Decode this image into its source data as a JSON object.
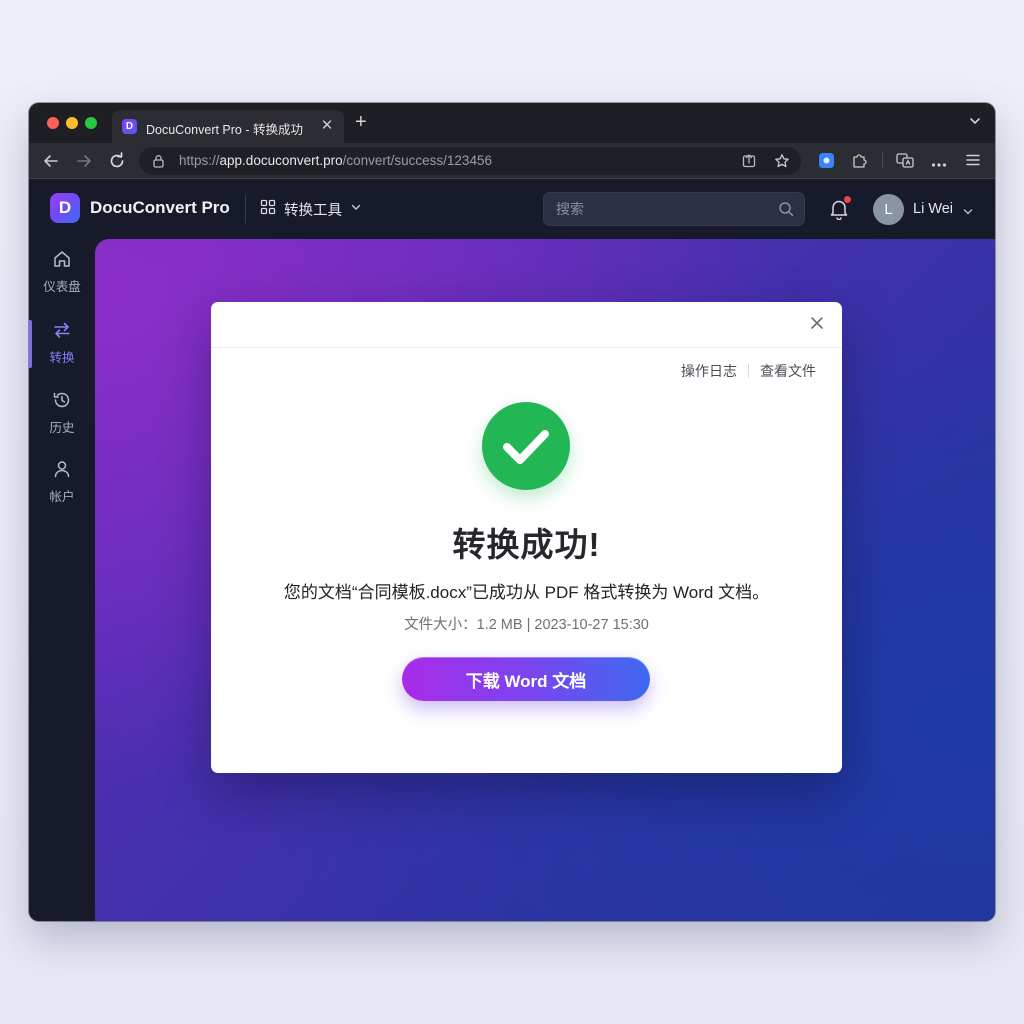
{
  "browser": {
    "tab_title": "DocuConvert Pro - 转换成功",
    "tab_favicon_letter": "D",
    "tab_close": "✕",
    "new_tab": "+",
    "url_prefix": "https://",
    "url_host": "app.docuconvert.pro",
    "url_path": "/convert/success/123456"
  },
  "header": {
    "logo_letter": "D",
    "brand": "DocuConvert Pro",
    "tools_label": "转换工具",
    "search_placeholder": "搜索",
    "avatar_initial": "L",
    "username": "Li Wei"
  },
  "sidebar": {
    "items": [
      {
        "label": "仪表盘",
        "icon": "home-icon"
      },
      {
        "label": "转换",
        "icon": "swap-icon",
        "active": true
      },
      {
        "label": "历史",
        "icon": "history-icon"
      },
      {
        "label": "帐户",
        "icon": "user-icon"
      }
    ]
  },
  "modal": {
    "links": [
      "操作日志",
      "查看文件"
    ],
    "title": "转换成功!",
    "message": "您的文档“合同模板.docx”已成功从 PDF 格式转换为 Word 文档。",
    "meta": "文件大小：1.2 MB | 2023-10-27 15:30",
    "download_label": "下载 Word 文档"
  },
  "colors": {
    "accent": "#7c6cf6",
    "success": "#22b655",
    "notification": "#ef4444"
  }
}
